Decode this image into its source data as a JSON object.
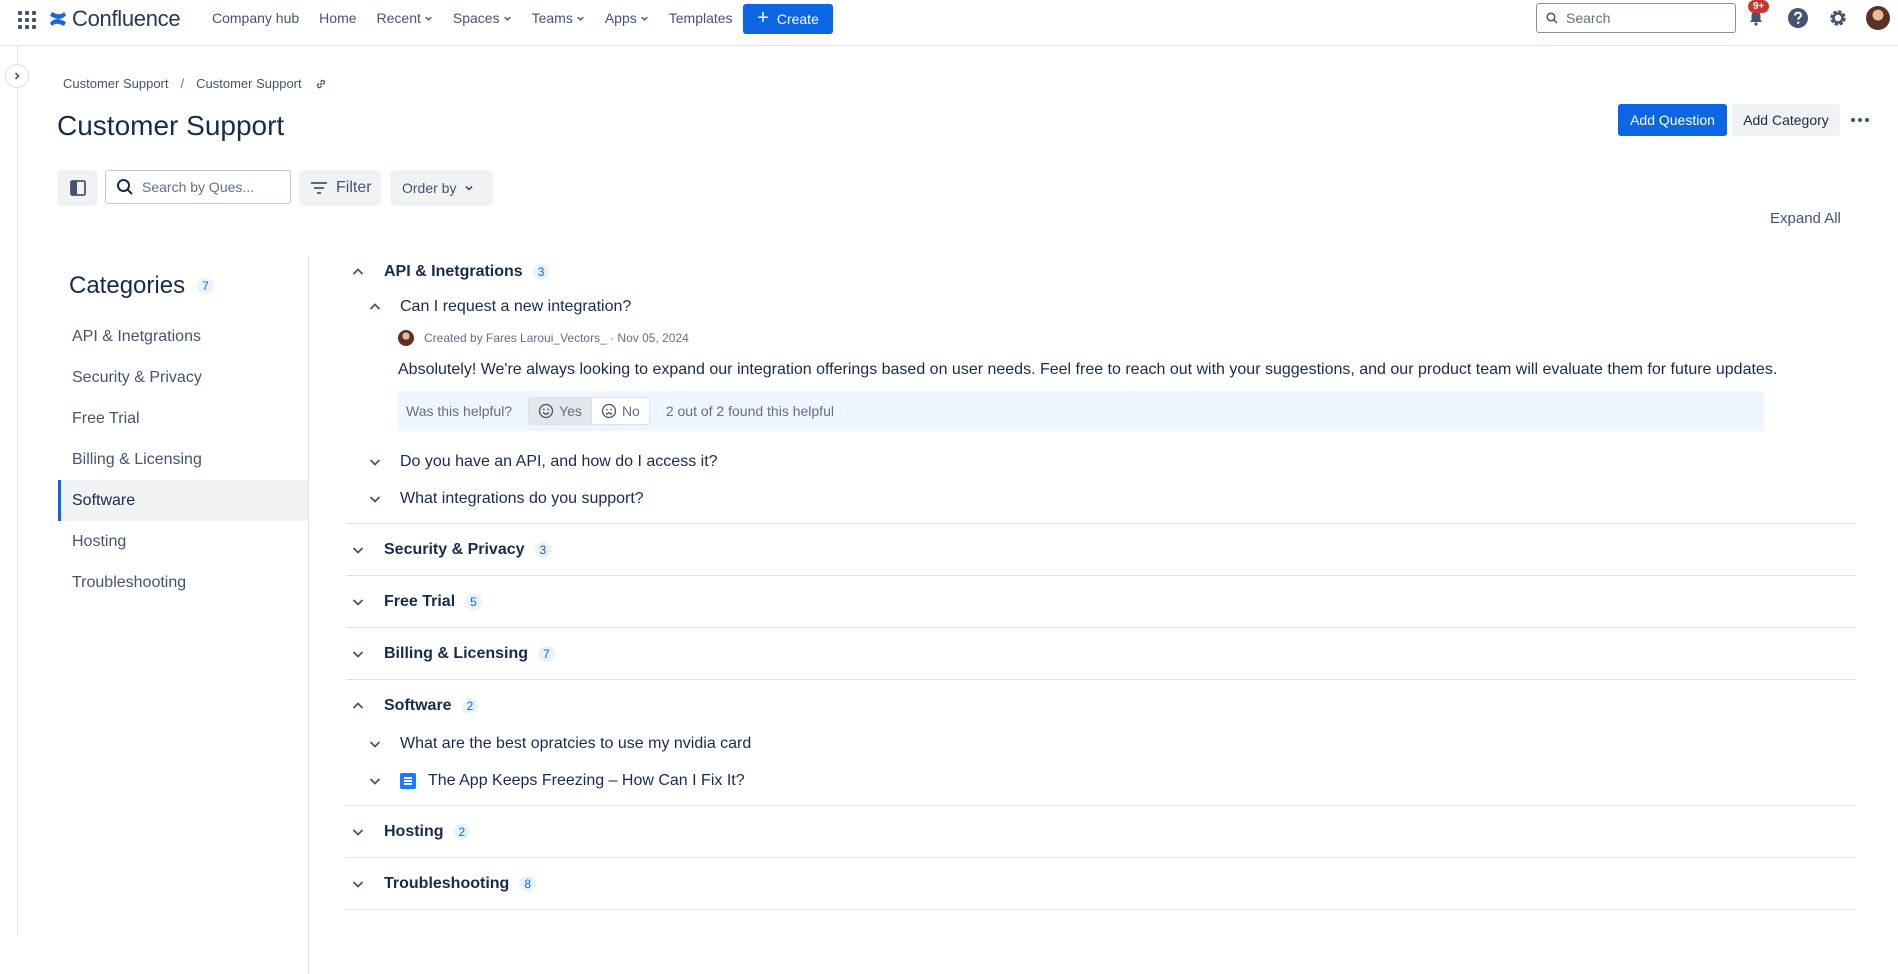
{
  "nav": {
    "logo_text": "Confluence",
    "links": [
      "Company hub",
      "Home",
      "Recent",
      "Spaces",
      "Teams",
      "Apps",
      "Templates"
    ],
    "create_label": "Create",
    "search_placeholder": "Search",
    "notification_badge": "9+"
  },
  "breadcrumb": [
    "Customer Support",
    "Customer Support"
  ],
  "page": {
    "title": "Customer Support",
    "add_question": "Add Question",
    "add_category": "Add Category"
  },
  "toolbar": {
    "search_placeholder": "Search by Ques...",
    "filter_label": "Filter",
    "order_label": "Order by",
    "expand_all": "Expand All"
  },
  "categories": {
    "title": "Categories",
    "count": "7",
    "items": [
      {
        "label": "API & Inetgrations",
        "active": false
      },
      {
        "label": "Security & Privacy",
        "active": false
      },
      {
        "label": "Free Trial",
        "active": false
      },
      {
        "label": "Billing & Licensing",
        "active": false
      },
      {
        "label": "Software",
        "active": true
      },
      {
        "label": "Hosting",
        "active": false
      },
      {
        "label": "Troubleshooting",
        "active": false
      }
    ]
  },
  "sections": [
    {
      "name": "API & Inetgrations",
      "count": "3",
      "expanded": true,
      "questions": [
        {
          "text": "Can I request a new integration?",
          "expanded": true,
          "meta": "Created by Fares Laroui_Vectors_ · Nov 05, 2024",
          "answer": "Absolutely! We're always looking to expand our integration offerings based on user needs. Feel free to reach out with your suggestions, and our product team will evaluate them for future updates.",
          "helpful_prompt": "Was this helpful?",
          "yes_label": "Yes",
          "no_label": "No",
          "helpful_count": "2 out of 2 found this helpful"
        },
        {
          "text": "Do you have an API, and how do I access it?",
          "expanded": false
        },
        {
          "text": "What integrations do you support?",
          "expanded": false
        }
      ]
    },
    {
      "name": "Security & Privacy",
      "count": "3",
      "expanded": false
    },
    {
      "name": "Free Trial",
      "count": "5",
      "expanded": false
    },
    {
      "name": "Billing & Licensing",
      "count": "7",
      "expanded": false
    },
    {
      "name": "Software",
      "count": "2",
      "expanded": true,
      "questions": [
        {
          "text": "What are the best opratcies to use my nvidia card",
          "expanded": false
        },
        {
          "text": "The App Keeps Freezing – How Can I Fix It?",
          "expanded": false,
          "doc_icon": true
        }
      ]
    },
    {
      "name": "Hosting",
      "count": "2",
      "expanded": false
    },
    {
      "name": "Troubleshooting",
      "count": "8",
      "expanded": false
    }
  ]
}
